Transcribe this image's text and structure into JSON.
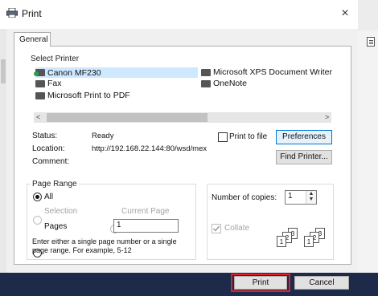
{
  "window": {
    "title": "Print",
    "close_glyph": "×"
  },
  "tabs": [
    {
      "label": "General"
    }
  ],
  "select_printer": {
    "label": "Select Printer",
    "printers": [
      {
        "name": "Canon MF230",
        "icon": "printer-default-icon"
      },
      {
        "name": "Microsoft XPS Document Writer",
        "icon": "printer-icon"
      },
      {
        "name": "Fax",
        "icon": "fax-icon"
      },
      {
        "name": "OneNote",
        "icon": "printer-icon"
      },
      {
        "name": "Microsoft Print to PDF",
        "icon": "printer-icon"
      }
    ],
    "selected": "Canon MF230",
    "scroll_left": "<",
    "scroll_right": ">"
  },
  "status": {
    "status_label": "Status:",
    "status_value": "Ready",
    "location_label": "Location:",
    "location_value": "http://192.168.22.144:80/wsd/mex",
    "comment_label": "Comment:"
  },
  "print_to_file": {
    "label": "Print to file",
    "checked": false
  },
  "buttons": {
    "preferences": "Preferences",
    "find_printer": "Find Printer...",
    "print": "Print",
    "cancel": "Cancel"
  },
  "page_range": {
    "label": "Page Range",
    "all": "All",
    "selection": "Selection",
    "current_page": "Current Page",
    "pages": "Pages",
    "pages_value": "1",
    "hint": "Enter either a single page number or a single page range.  For example, 5-12",
    "selected": "All"
  },
  "copies": {
    "label": "Number of copies:",
    "value": "1",
    "collate_label": "Collate",
    "collate_checked": true,
    "collate_pages": [
      "1",
      "2",
      "3",
      "1",
      "2",
      "3"
    ]
  },
  "colors": {
    "accent": "#0078d7",
    "highlight": "#e0202a",
    "taskbar": "#1e2a4a"
  }
}
